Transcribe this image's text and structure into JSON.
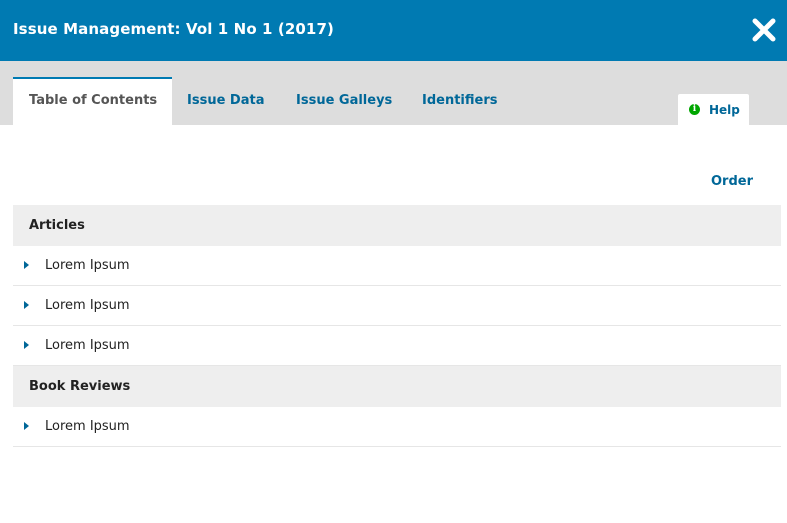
{
  "modal": {
    "title": "Issue Management: Vol 1 No 1 (2017)",
    "close_icon": "close-icon"
  },
  "tabs": [
    {
      "label": "Table of Contents",
      "active": true
    },
    {
      "label": "Issue Data",
      "active": false
    },
    {
      "label": "Issue Galleys",
      "active": false
    },
    {
      "label": "Identifiers",
      "active": false
    }
  ],
  "help": {
    "label": "Help",
    "icon": "info-icon"
  },
  "order_label": "Order",
  "sections": [
    {
      "name": "Articles",
      "items": [
        "Lorem Ipsum",
        "Lorem Ipsum",
        "Lorem Ipsum"
      ]
    },
    {
      "name": "Book Reviews",
      "items": [
        "Lorem Ipsum"
      ]
    }
  ],
  "colors": {
    "header": "#007ab2",
    "link": "#006798",
    "tabbar": "#dddddd",
    "category_bg": "#eeeeee",
    "help_icon": "#00a600"
  }
}
